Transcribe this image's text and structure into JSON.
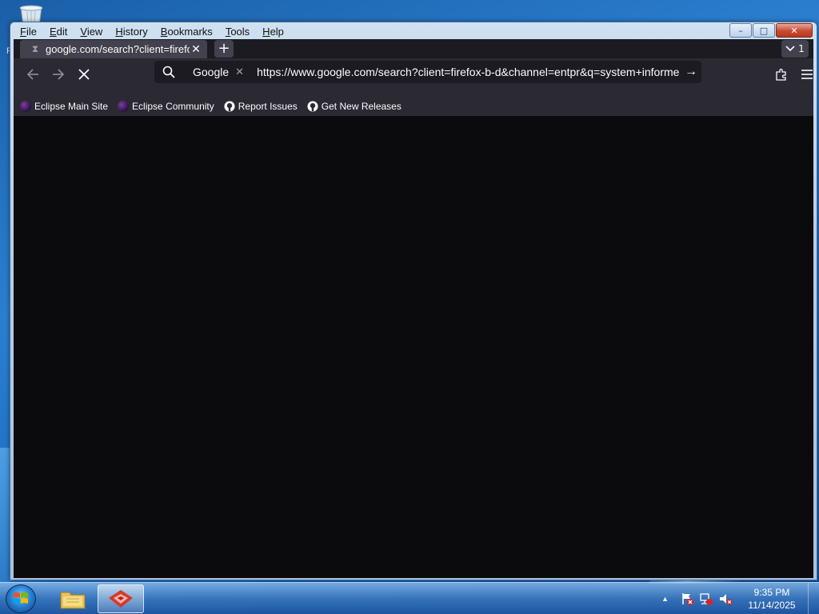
{
  "desktop": {
    "stray_label": "F"
  },
  "window": {
    "controls": {
      "minimize": "–",
      "maximize": "□",
      "close": "✕"
    }
  },
  "menubar": {
    "items": [
      "File",
      "Edit",
      "View",
      "History",
      "Bookmarks",
      "Tools",
      "Help"
    ]
  },
  "tabs": [
    {
      "title": "google.com/search?client=firefo",
      "loading": true,
      "close": "✕"
    }
  ],
  "tab_strip": {
    "new_tab": "+",
    "tab_count": "1"
  },
  "navbar": {
    "search_engine": "Google",
    "url": "https://www.google.com/search?client=firefox-b-d&channel=entpr&q=system+informe",
    "go": "→"
  },
  "bookmarks": [
    {
      "label": "Eclipse Main Site",
      "icon": "eclipse-icon"
    },
    {
      "label": "Eclipse Community",
      "icon": "eclipse-icon"
    },
    {
      "label": "Report Issues",
      "icon": "github-icon"
    },
    {
      "label": "Get New Releases",
      "icon": "github-icon"
    }
  ],
  "taskbar": {
    "items": [
      {
        "name": "file-explorer",
        "icon": "folder-icon",
        "active": false
      },
      {
        "name": "browser",
        "icon": "app-icon",
        "active": true
      }
    ],
    "tray": {
      "overflow": "▲"
    },
    "clock": {
      "time": "9:35 PM",
      "date": "11/14/2025"
    }
  },
  "colors": {
    "chrome_bg": "#2b2a33",
    "tab_bg": "#42414d",
    "urlbar_bg": "#1c1b22",
    "content_bg": "#0b0b0e",
    "text": "#fbfbfe"
  }
}
